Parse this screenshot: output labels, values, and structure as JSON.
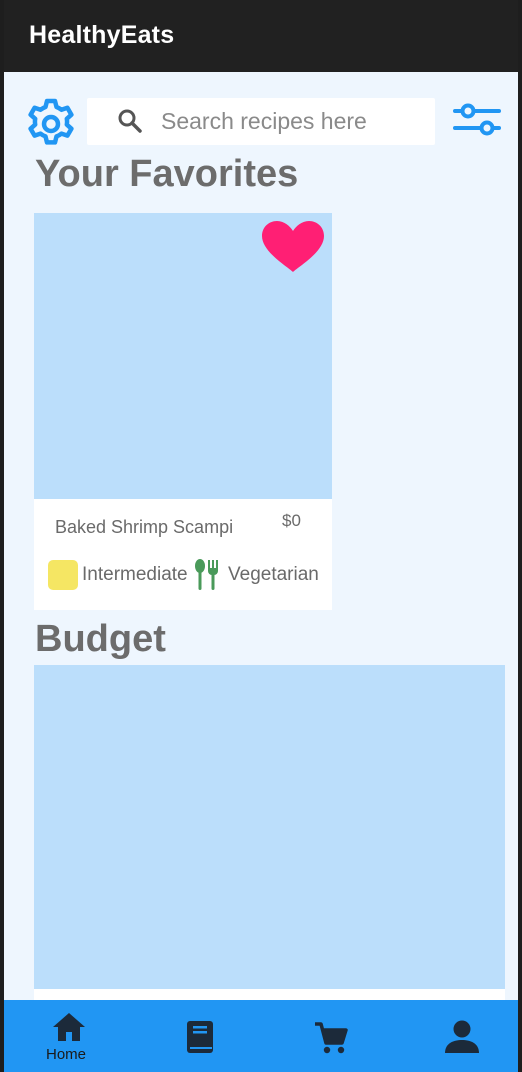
{
  "app": {
    "title": "HealthyEats"
  },
  "search": {
    "placeholder": "Search recipes here"
  },
  "favorites": {
    "heading": "Your Favorites",
    "items": [
      {
        "name": "Baked Shrimp Scampi",
        "price": "$0",
        "difficulty": "Intermediate",
        "diet": "Vegetarian"
      }
    ]
  },
  "budget": {
    "heading": "Budget"
  },
  "nav": {
    "items": [
      {
        "label": "Home"
      },
      {
        "label": ""
      },
      {
        "label": ""
      },
      {
        "label": ""
      }
    ]
  },
  "icons": {
    "settings": "gear-icon",
    "search": "search-icon",
    "filters": "sliders-icon",
    "favorite": "heart-icon",
    "diet": "fork-spoon-icon",
    "home": "home-icon",
    "book": "book-icon",
    "cart": "cart-icon",
    "profile": "person-icon"
  },
  "colors": {
    "accent": "#2196f3",
    "background": "#eef6fe",
    "image_placeholder": "#bbdefb",
    "heart": "#ff1f74",
    "difficulty": "#f5e663",
    "diet": "#4a9a5a",
    "titlebar": "#212121"
  }
}
